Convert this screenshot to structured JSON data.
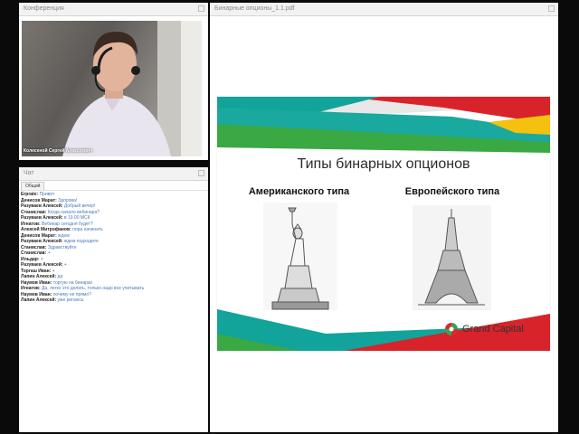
{
  "conference": {
    "title": "Конференция",
    "presenter_name": "Колесеной Сергей Алексеевич"
  },
  "chat": {
    "title": "Чат",
    "tab": "Общий",
    "messages": [
      {
        "author": "Erprate:",
        "text": "Привет"
      },
      {
        "author": "Денисов Марат:",
        "text": "Здорова!"
      },
      {
        "author": "Разуваев Алексей:",
        "text": "Добрый вечер!"
      },
      {
        "author": "Станислав:",
        "text": "Когда начало вебинара?"
      },
      {
        "author": "Разуваев Алексей:",
        "text": "в 19.00 МСК"
      },
      {
        "author": "Игнатов:",
        "text": "Вебинар сегодня будет?"
      },
      {
        "author": "Алексей Митрофанов:",
        "text": "пора начинать"
      },
      {
        "author": "Денисов Марат:",
        "text": "ждем"
      },
      {
        "author": "Разуваев Алексей:",
        "text": "ждем подходите"
      },
      {
        "author": "Станислав:",
        "text": "Здравствуйте"
      },
      {
        "author": "Станислав:",
        "text": "+"
      },
      {
        "author": "Ильдар:",
        "text": "+"
      },
      {
        "author": "Разуваев Алексей:",
        "text": "+"
      },
      {
        "author": "Торгаш Иван:",
        "text": "+"
      },
      {
        "author": "Лапин Алексей:",
        "text": "да"
      },
      {
        "author": "Наумов Иван:",
        "text": "торгую на бинарах"
      },
      {
        "author": "Игнатов:",
        "text": "Да, легко это делать, только надо все учитывать"
      },
      {
        "author": "Наумов Иван:",
        "text": "почему не прямо?"
      },
      {
        "author": "Лапин Алексей:",
        "text": "уже регаюсь"
      }
    ]
  },
  "presentation": {
    "title": "Бинарные опционы_1.1.pdf",
    "slide": {
      "heading": "Типы бинарных опционов",
      "left_label": "Американского типа",
      "right_label": "Европейского типа",
      "logo_text": "Grand Capital"
    }
  },
  "colors": {
    "slide_red": "#d8232a",
    "slide_teal": "#12a39a",
    "slide_green": "#3aa843",
    "slide_yellow": "#f4c10f",
    "logo_red": "#e2262d",
    "logo_green": "#2fa84f"
  }
}
